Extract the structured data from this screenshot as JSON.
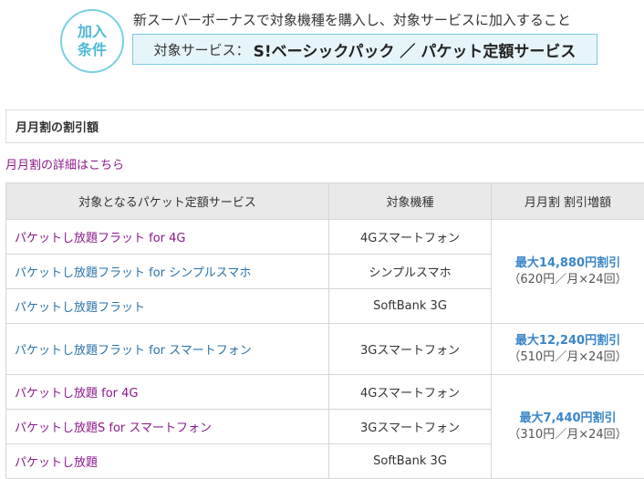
{
  "header": {
    "circle_line1": "加入",
    "circle_line2": "条件",
    "condition_text": "新スーパーボーナスで対象機種を購入し、対象サービスに加入すること",
    "service_label": "対象サービス：",
    "service_value": "S!ベーシックパック ／ パケット定額サービス"
  },
  "section": {
    "title": "月月割の割引額",
    "detail_link": "月月割の詳細はこちら"
  },
  "table": {
    "headers": [
      "対象となるパケット定額サービス",
      "対象機種",
      "月月割 割引増額"
    ],
    "rows": [
      {
        "service": "パケットし放題フラット for 4G",
        "device": "4Gスマートフォン"
      },
      {
        "service": "パケットし放題フラット for シンプルスマホ",
        "device": "シンプルスマホ"
      },
      {
        "service": "パケットし放題フラット",
        "device": "SoftBank 3G"
      },
      {
        "service": "パケットし放題フラット for スマートフォン",
        "device": "3Gスマートフォン"
      },
      {
        "service": "パケットし放題 for 4G",
        "device": "4Gスマートフォン"
      },
      {
        "service": "パケットし放題S for スマートフォン",
        "device": "3Gスマートフォン"
      },
      {
        "service": "パケットし放題",
        "device": "SoftBank 3G"
      }
    ],
    "discounts": [
      {
        "main": "最大14,880円割引",
        "sub": "（620円／月×24回）"
      },
      {
        "main": "最大12,240円割引",
        "sub": "（510円／月×24回）"
      },
      {
        "main": "最大7,440円割引",
        "sub": "（310円／月×24回）"
      }
    ]
  },
  "colors": {
    "accent_circle": "#4fb9d5",
    "visited_link": "#8a1a8a",
    "link": "#2a73a8",
    "discount": "#3a86c8"
  }
}
